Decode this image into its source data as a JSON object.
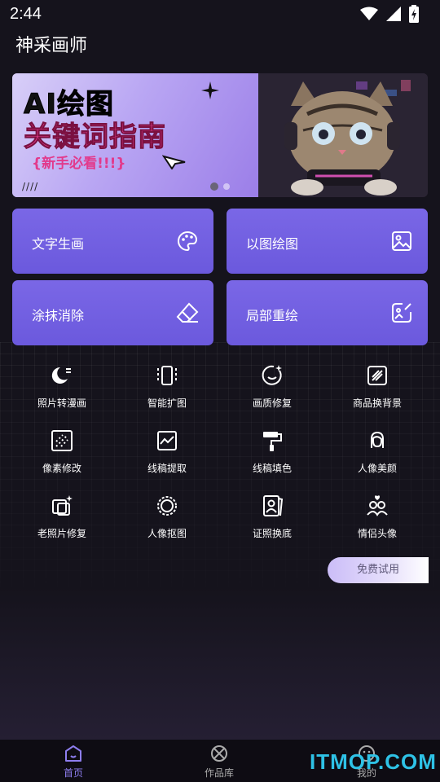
{
  "status_bar": {
    "time": "2:44"
  },
  "app": {
    "title": "神采画师"
  },
  "banner": {
    "line1": "AI绘图",
    "line2": "关键词指南",
    "line3": "{新手必看!!!}",
    "slides": 2,
    "active_slide": 1
  },
  "cards": [
    {
      "label": "文字生画",
      "icon": "palette-icon"
    },
    {
      "label": "以图绘图",
      "icon": "image-icon"
    },
    {
      "label": "涂抹消除",
      "icon": "eraser-icon"
    },
    {
      "label": "局部重绘",
      "icon": "edit-image-icon"
    }
  ],
  "tools": [
    {
      "label": "照片转漫画",
      "icon": "moon-icon"
    },
    {
      "label": "智能扩图",
      "icon": "expand-icon"
    },
    {
      "label": "画质修复",
      "icon": "quality-icon"
    },
    {
      "label": "商品换背景",
      "icon": "background-icon"
    },
    {
      "label": "像素修改",
      "icon": "pixel-icon"
    },
    {
      "label": "线稿提取",
      "icon": "lineart-icon"
    },
    {
      "label": "线稿填色",
      "icon": "paint-roller-icon"
    },
    {
      "label": "人像美颜",
      "icon": "face-icon"
    },
    {
      "label": "老照片修复",
      "icon": "old-photo-icon"
    },
    {
      "label": "人像抠图",
      "icon": "cutout-icon"
    },
    {
      "label": "证照换底",
      "icon": "id-photo-icon"
    },
    {
      "label": "情侣头像",
      "icon": "couple-icon"
    }
  ],
  "trial_button": "免费试用",
  "nav": [
    {
      "label": "首页",
      "icon": "home-icon",
      "active": true
    },
    {
      "label": "作品库",
      "icon": "gallery-icon",
      "active": false
    },
    {
      "label": "我的",
      "icon": "profile-icon",
      "active": false
    }
  ],
  "watermark": "ITMOP.COM",
  "colors": {
    "card": "#6b59dd",
    "accent": "#8e7ef0",
    "background": "#15131c"
  }
}
